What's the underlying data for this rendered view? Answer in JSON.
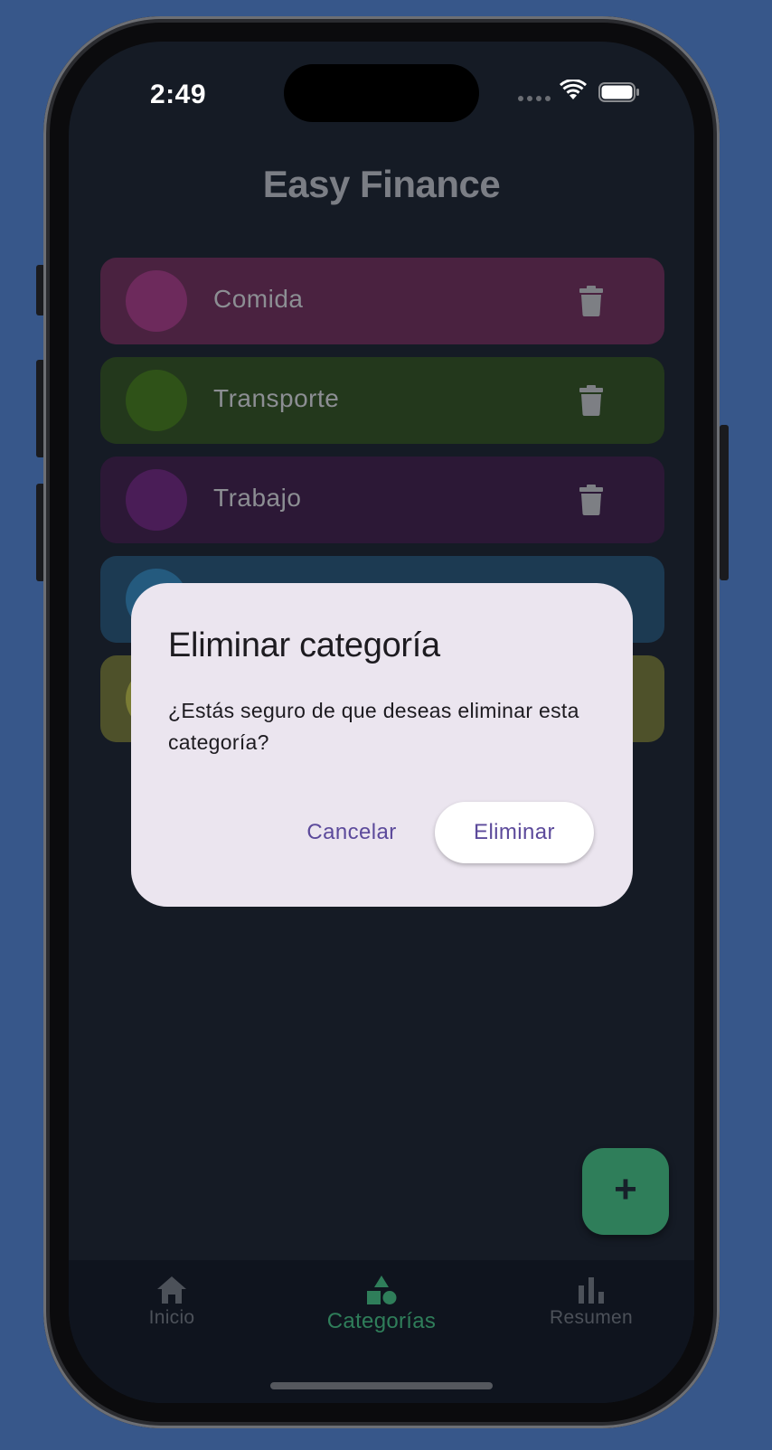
{
  "status_bar": {
    "time": "2:49"
  },
  "app": {
    "title": "Easy Finance"
  },
  "categories": [
    {
      "label": "Comida",
      "row_color": "#4a2240",
      "circle_color": "#6d2a5c"
    },
    {
      "label": "Transporte",
      "row_color": "#23381c",
      "circle_color": "#2f5218"
    },
    {
      "label": "Trabajo",
      "row_color": "#2c1836",
      "circle_color": "#4a1d57"
    },
    {
      "label": "",
      "row_color": "#1c3a52",
      "circle_color": "#245a7e"
    },
    {
      "label": "",
      "row_color": "#4e512a",
      "circle_color": "#7a7c34"
    }
  ],
  "dialog": {
    "title": "Eliminar categoría",
    "body": "¿Estás seguro de que deseas eliminar esta categoría?",
    "cancel_label": "Cancelar",
    "confirm_label": "Eliminar"
  },
  "fab": {
    "label": "+"
  },
  "bottom_nav": {
    "items": [
      {
        "label": "Inicio",
        "icon": "home-icon"
      },
      {
        "label": "Categorías",
        "icon": "shapes-icon",
        "active": true
      },
      {
        "label": "Resumen",
        "icon": "bar-chart-icon"
      }
    ]
  },
  "colors": {
    "accent": "#2f7e5a",
    "dialog_bg": "#ebe5ef",
    "dialog_button_text": "#5c4a9b"
  }
}
